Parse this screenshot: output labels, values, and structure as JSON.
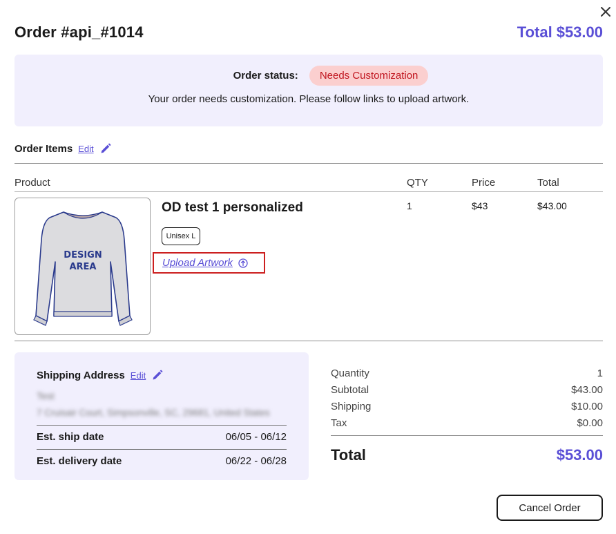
{
  "header": {
    "title": "Order #api_#1014",
    "total_label": "Total",
    "total_value": "$53.00"
  },
  "status": {
    "label": "Order status:",
    "badge": "Needs Customization",
    "message": "Your order needs customization. Please follow links to upload artwork."
  },
  "items_section": {
    "title": "Order Items",
    "edit_label": "Edit"
  },
  "table": {
    "headers": [
      "Product",
      "QTY",
      "Price",
      "Total"
    ],
    "rows": [
      {
        "name": "OD test 1 personalized",
        "variant": "Unisex L",
        "upload_label": "Upload Artwork",
        "image_text": [
          "DESIGN",
          "AREA"
        ],
        "qty": "1",
        "price": "$43",
        "total": "$43.00"
      }
    ]
  },
  "shipping": {
    "title": "Shipping Address",
    "edit_label": "Edit",
    "name": "Test",
    "address": "7 Cruisair Court, Simpsonville, SC, 29681, United States",
    "ship_date_label": "Est. ship date",
    "ship_date": "06/05 - 06/12",
    "delivery_label": "Est. delivery date",
    "delivery_date": "06/22 - 06/28"
  },
  "summary": {
    "rows": [
      {
        "label": "Quantity",
        "value": "1"
      },
      {
        "label": "Subtotal",
        "value": "$43.00"
      },
      {
        "label": "Shipping",
        "value": "$10.00"
      },
      {
        "label": "Tax",
        "value": "$0.00"
      }
    ],
    "total_label": "Total",
    "total_value": "$53.00"
  },
  "actions": {
    "cancel_label": "Cancel Order"
  },
  "colors": {
    "accent": "#5a4fd6",
    "status_bg": "#fbcfcf",
    "status_text": "#c0141e",
    "panel_bg": "#f1effd",
    "highlight": "#cc1f1f"
  },
  "icons": {
    "close": "close-icon",
    "edit": "pencil-icon",
    "upload": "upload-circle-arrow-icon"
  }
}
